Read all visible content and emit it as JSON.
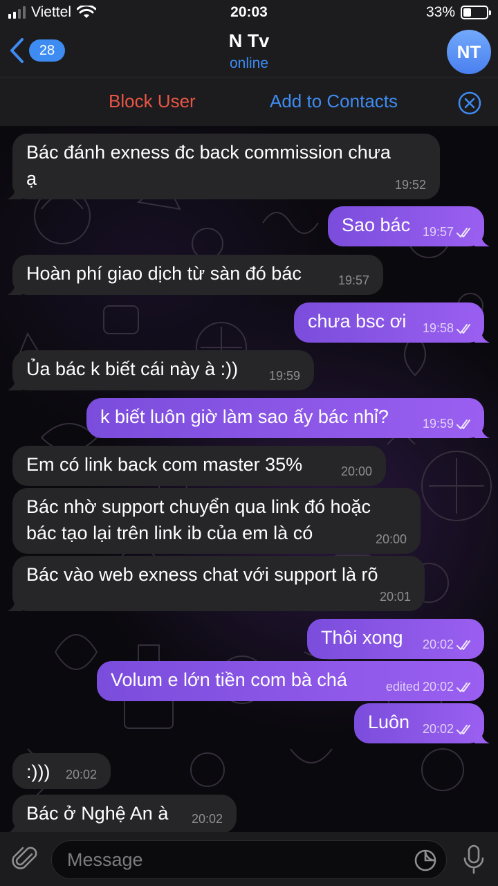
{
  "status_bar": {
    "carrier": "Viettel",
    "time": "20:03",
    "battery_percent": "33%",
    "battery_level": 0.33
  },
  "header": {
    "back_count": "28",
    "title": "N Tv",
    "subtitle": "online",
    "avatar_initials": "NT"
  },
  "action_bar": {
    "block_label": "Block User",
    "add_label": "Add to Contacts",
    "close_icon": "close-circle-icon"
  },
  "messages": [
    {
      "dir": "in",
      "lines": [
        "Bác đánh exness đc back commission chưa",
        "ạ"
      ],
      "time": "19:52"
    },
    {
      "dir": "out",
      "lines": [
        "Sao bác"
      ],
      "time": "19:57",
      "read": true
    },
    {
      "dir": "in",
      "lines": [
        "Hoàn phí giao dịch từ sàn đó bác"
      ],
      "time": "19:57"
    },
    {
      "dir": "out",
      "lines": [
        "chưa bsc ơi"
      ],
      "time": "19:58",
      "read": true
    },
    {
      "dir": "in",
      "lines": [
        "Ủa bác k biết cái này à :))"
      ],
      "time": "19:59"
    },
    {
      "dir": "out",
      "lines": [
        "k biết luôn giờ làm sao ấy bác nhỉ?"
      ],
      "time": "19:59",
      "read": true
    },
    {
      "dir": "in",
      "lines": [
        "Em có link back com master 35%"
      ],
      "time": "20:00"
    },
    {
      "dir": "in",
      "lines": [
        "Bác nhờ support chuyển qua link đó hoặc",
        "bác tạo lại trên link ib của em là có"
      ],
      "time": "20:00"
    },
    {
      "dir": "in",
      "lines": [
        "Bác vào web exness chat với support là rõ"
      ],
      "time": "20:01"
    },
    {
      "dir": "out",
      "lines": [
        "Thôi xong"
      ],
      "time": "20:02",
      "read": true
    },
    {
      "dir": "out",
      "lines": [
        "Volum e lớn tiền com bà chá"
      ],
      "time": "20:02",
      "edited": "edited",
      "read": true
    },
    {
      "dir": "out",
      "lines": [
        "Luôn"
      ],
      "time": "20:02",
      "read": true
    },
    {
      "dir": "in",
      "lines": [
        ":)))"
      ],
      "time": "20:02"
    },
    {
      "dir": "in",
      "lines": [
        "Bác ở Nghệ An à"
      ],
      "time": "20:02"
    }
  ],
  "input": {
    "placeholder": "Message"
  },
  "icons": {
    "attach": "paperclip-icon",
    "sticker": "sticker-icon",
    "mic": "microphone-icon",
    "back": "chevron-left-icon",
    "read": "double-check-icon"
  },
  "colors": {
    "accent": "#3e8cf2",
    "danger": "#eb5545",
    "outgoing_bubble": "#8a55e8",
    "incoming_bubble": "#262628"
  }
}
